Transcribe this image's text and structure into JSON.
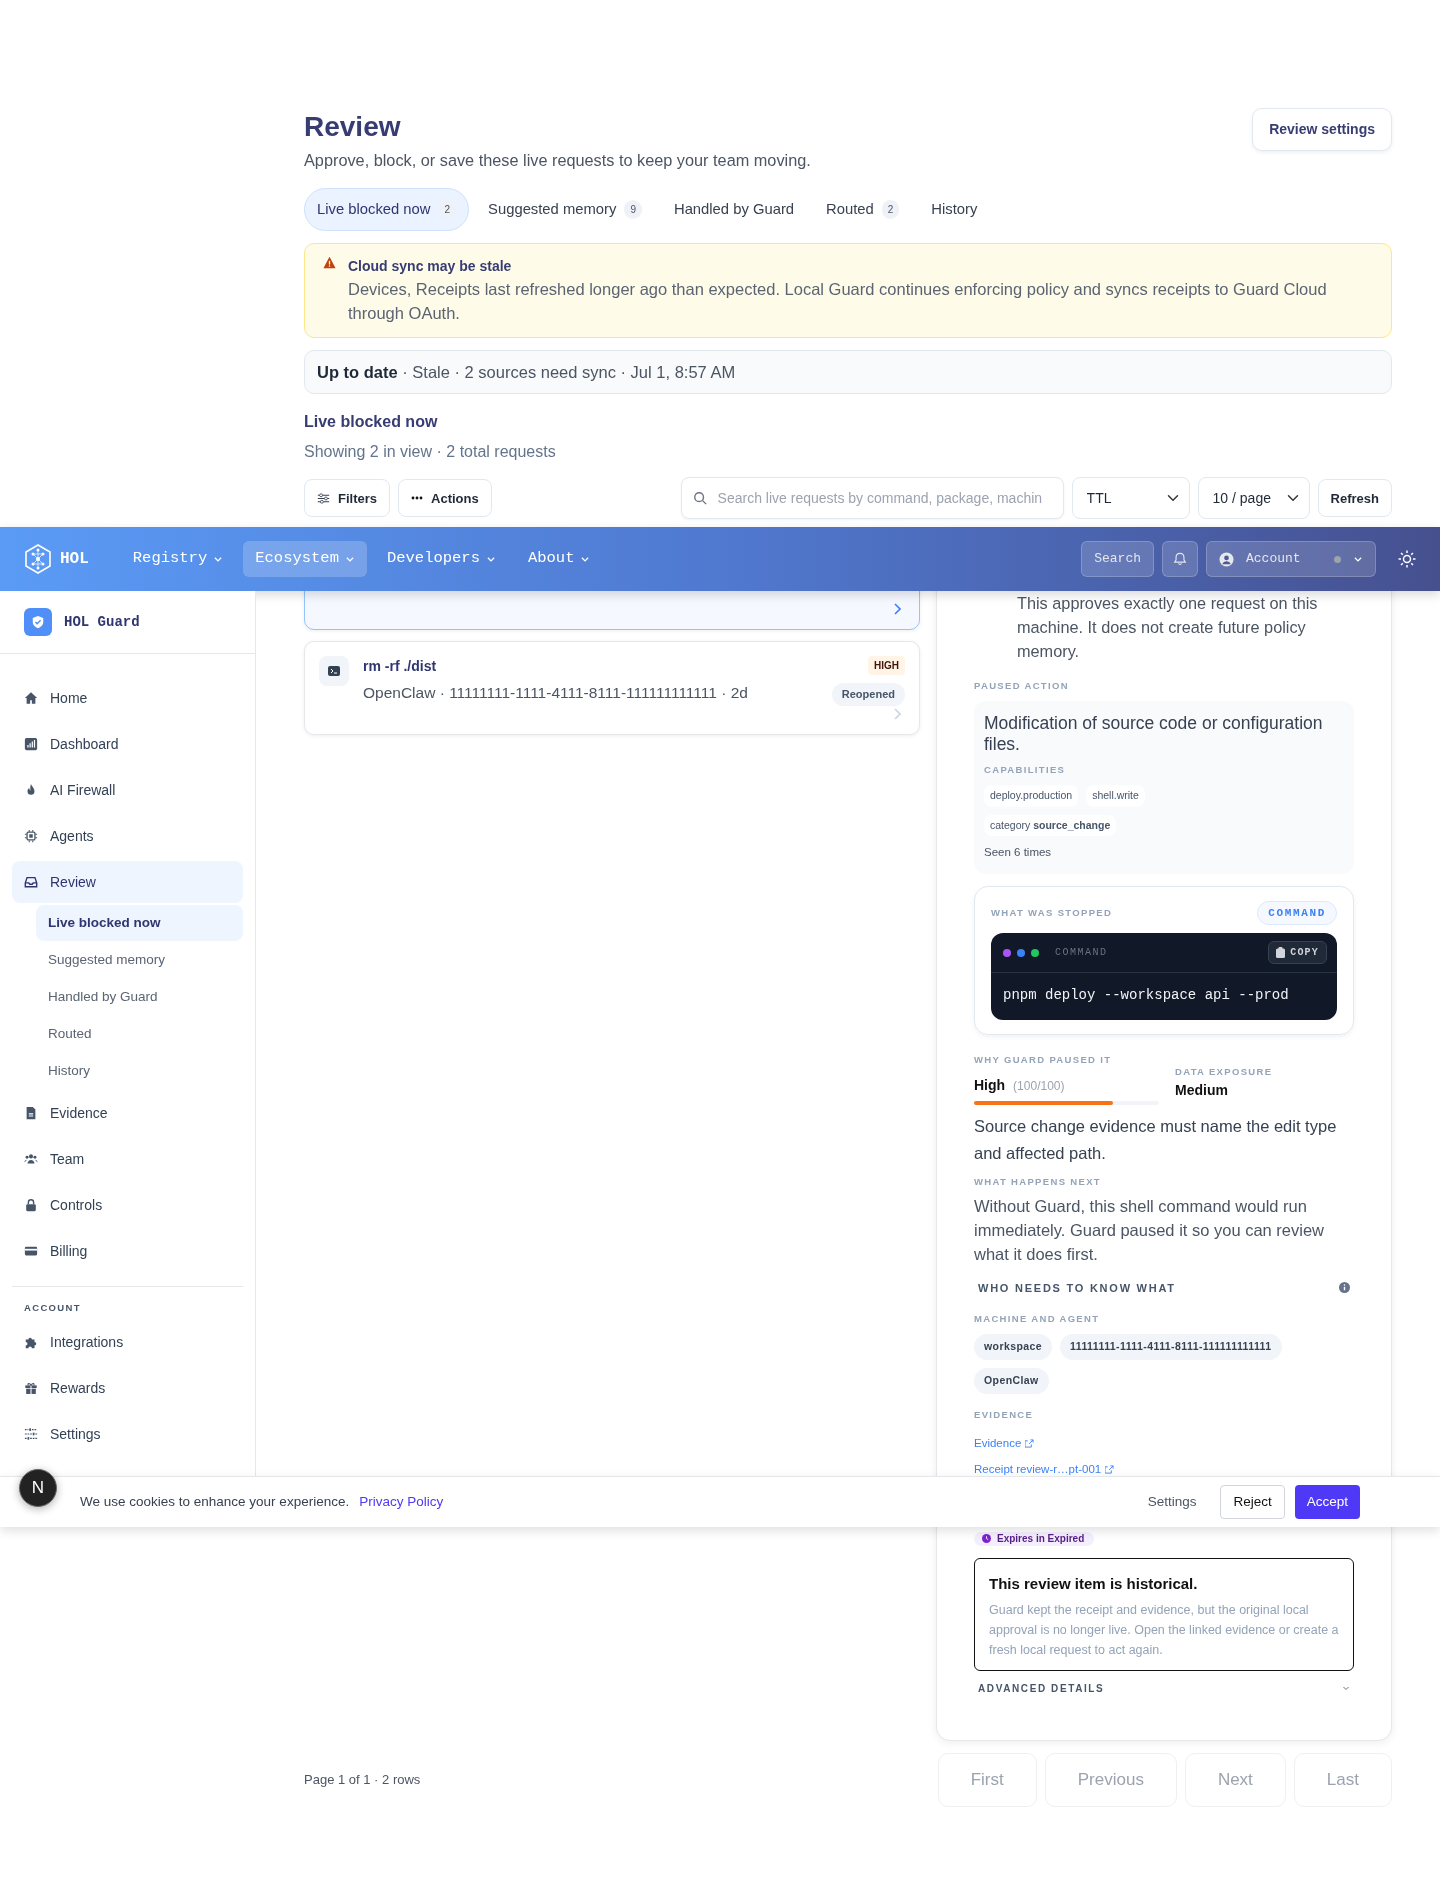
{
  "header": {
    "title": "Review",
    "subtitle": "Approve, block, or save these live requests to keep your team moving.",
    "settings_button": "Review settings"
  },
  "tabs": [
    {
      "label": "Live blocked now",
      "count": "2",
      "selected": true
    },
    {
      "label": "Suggested memory",
      "count": "9",
      "selected": false
    },
    {
      "label": "Handled by Guard",
      "selected": false
    },
    {
      "label": "Routed",
      "count": "2",
      "selected": false
    },
    {
      "label": "History",
      "selected": false
    }
  ],
  "alert": {
    "title": "Cloud sync may be stale",
    "message": "Devices, Receipts last refreshed longer ago than expected. Local Guard continues enforcing policy and syncs receipts to Guard Cloud through OAuth."
  },
  "sync_status": "**Up to date** · Stale · 2 sources need sync · Jul 1, 8:57 AM",
  "section": {
    "title": "Live blocked now",
    "summary": "Showing 2 in view · 2 total requests"
  },
  "toolbar": {
    "filters": "Filters",
    "actions": "Actions",
    "search_placeholder": "Search live requests by command, package, machin",
    "ttl_select": "TTL",
    "page_size_select": "10 / page",
    "refresh": "Refresh"
  },
  "requests": [
    {
      "selected": true
    },
    {
      "command": "rm -rf ./dist",
      "meta": "OpenClaw · 11111111-1111-4111-8111-111111111111 · 2d",
      "risk": "HIGH",
      "status": "Reopened",
      "selected": false
    }
  ],
  "detail": {
    "approval_note": "This approves exactly one request on this machine. It does not create future policy memory.",
    "paused_action": {
      "label": "PAUSED ACTION",
      "description": "Modification of source code or configuration files.",
      "capabilities_label": "CAPABILITIES",
      "capabilities": [
        "deploy.production",
        "shell.write"
      ],
      "category": "category **source_change**",
      "seen": "Seen 6 times"
    },
    "stopped": {
      "label": "WHAT WAS STOPPED",
      "type": "COMMAND",
      "terminal_title": "COMMAND",
      "copy": "COPY",
      "command": "pnpm deploy --workspace api --prod"
    },
    "risk": {
      "label": "WHY GUARD PAUSED IT",
      "rating": "High",
      "score": "(100/100)",
      "level": 0.75,
      "exposure_label": "DATA EXPOSURE",
      "exposure": "Medium",
      "reason": "Source change evidence must name the edit type and affected path."
    },
    "next": {
      "label": "WHAT HAPPENS NEXT",
      "text": "Without Guard, this shell command would run immediately. Guard paused it so you can review what it does first."
    },
    "who_title": "WHO NEEDS TO KNOW WHAT",
    "machine": {
      "label": "MACHINE AND AGENT",
      "chips": [
        "workspace",
        "11111111-1111-4111-8111-111111111111",
        "OpenClaw"
      ]
    },
    "evidence": {
      "label": "EVIDENCE",
      "links": [
        "Evidence",
        "Receipt review-r…pt-001"
      ]
    },
    "expiry": "Expires in Expired",
    "historical": {
      "title": "This review item is historical.",
      "text": "Guard kept the receipt and evidence, but the original local approval is no longer live. Open the linked evidence or create a fresh local request to act again."
    },
    "advanced": {
      "label": "ADVANCED DETAILS",
      "expanded": false
    }
  },
  "pagination": {
    "summary": "Page 1 of 1 · 2 rows",
    "buttons": [
      {
        "label": "First",
        "disabled": true
      },
      {
        "label": "Previous",
        "disabled": true
      },
      {
        "label": "Next",
        "disabled": true
      },
      {
        "label": "Last",
        "disabled": true
      }
    ]
  },
  "navbar": {
    "brand": "HOL",
    "menus": [
      {
        "label": "Registry",
        "selected": false
      },
      {
        "label": "Ecosystem",
        "selected": true
      },
      {
        "label": "Developers",
        "selected": false
      },
      {
        "label": "About",
        "selected": false
      }
    ],
    "search": "Search",
    "account": "Account"
  },
  "sidebar": {
    "brand": "HOL Guard",
    "items": [
      {
        "label": "Home",
        "selected": false
      },
      {
        "label": "Dashboard",
        "selected": false
      },
      {
        "label": "AI Firewall",
        "selected": false
      },
      {
        "label": "Agents",
        "selected": false
      },
      {
        "label": "Review",
        "selected": true,
        "children": [
          {
            "label": "Live blocked now",
            "selected": true
          },
          {
            "label": "Suggested memory",
            "selected": false
          },
          {
            "label": "Handled by Guard",
            "selected": false
          },
          {
            "label": "Routed",
            "selected": false
          },
          {
            "label": "History",
            "selected": false
          }
        ]
      },
      {
        "label": "Evidence",
        "selected": false
      },
      {
        "label": "Team",
        "selected": false
      },
      {
        "label": "Controls",
        "selected": false
      },
      {
        "label": "Billing",
        "selected": false
      }
    ],
    "account_heading": "ACCOUNT",
    "account_items": [
      {
        "label": "Integrations",
        "selected": false
      },
      {
        "label": "Rewards",
        "selected": false
      },
      {
        "label": "Settings",
        "selected": false
      }
    ]
  },
  "cookie": {
    "message": "We use cookies to enhance your experience.",
    "link": "Privacy Policy",
    "settings": "Settings",
    "reject": "Reject",
    "accept": "Accept"
  },
  "dev_badge": "N"
}
